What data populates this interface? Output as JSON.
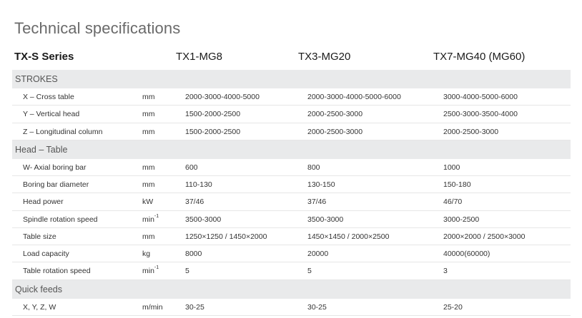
{
  "title": "Technical specifications",
  "header": {
    "series": "TX-S Series",
    "models": [
      "TX1-MG8",
      "TX3-MG20",
      "TX7-MG40 (MG60)"
    ]
  },
  "sections": [
    {
      "label": "STROKES",
      "rows": [
        {
          "label": "X – Cross table",
          "unit": "mm",
          "unit_sup": "",
          "values": [
            "2000-3000-4000-5000",
            "2000-3000-4000-5000-6000",
            "3000-4000-5000-6000"
          ]
        },
        {
          "label": "Y – Vertical head",
          "unit": "mm",
          "unit_sup": "",
          "values": [
            "1500-2000-2500",
            "2000-2500-3000",
            "2500-3000-3500-4000"
          ]
        },
        {
          "label": "Z – Longitudinal column",
          "unit": "mm",
          "unit_sup": "",
          "values": [
            "1500-2000-2500",
            "2000-2500-3000",
            "2000-2500-3000"
          ]
        }
      ]
    },
    {
      "label": "Head – Table",
      "rows": [
        {
          "label": "W- Axial boring bar",
          "unit": "mm",
          "unit_sup": "",
          "values": [
            "600",
            "800",
            "1000"
          ]
        },
        {
          "label": "Boring bar diameter",
          "unit": "mm",
          "unit_sup": "",
          "values": [
            "110-130",
            "130-150",
            "150-180"
          ]
        },
        {
          "label": "Head power",
          "unit": "kW",
          "unit_sup": "",
          "values": [
            "37/46",
            "37/46",
            "46/70"
          ]
        },
        {
          "label": "Spindle rotation speed",
          "unit": "min",
          "unit_sup": "-1",
          "values": [
            "3500-3000",
            "3500-3000",
            "3000-2500"
          ]
        },
        {
          "label": "Table size",
          "unit": "mm",
          "unit_sup": "",
          "values": [
            "1250×1250 / 1450×2000",
            "1450×1450 / 2000×2500",
            "2000×2000 / 2500×3000"
          ]
        },
        {
          "label": "Load capacity",
          "unit": "kg",
          "unit_sup": "",
          "values": [
            "8000",
            "20000",
            "40000(60000)"
          ]
        },
        {
          "label": "Table rotation speed",
          "unit": "min",
          "unit_sup": "-1",
          "values": [
            "5",
            "5",
            "3"
          ]
        }
      ]
    },
    {
      "label": "Quick feeds",
      "rows": [
        {
          "label": "X, Y, Z, W",
          "unit": "m/min",
          "unit_sup": "",
          "values": [
            "30-25",
            "30-25",
            "25-20"
          ]
        }
      ]
    }
  ]
}
